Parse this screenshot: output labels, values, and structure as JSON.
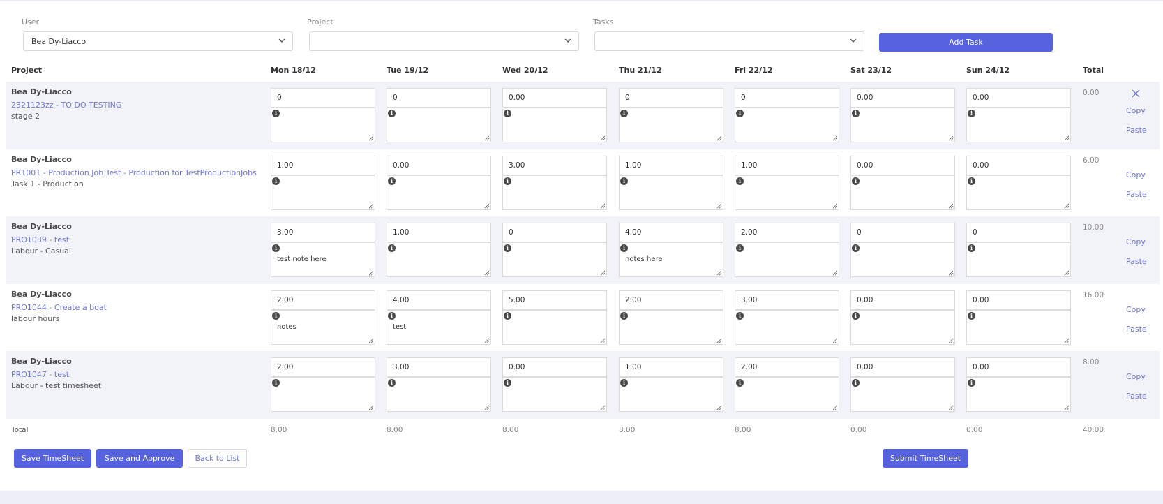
{
  "filters": {
    "user_label": "User",
    "user_value": "Bea Dy-Liacco",
    "project_label": "Project",
    "project_value": "",
    "tasks_label": "Tasks",
    "tasks_value": "",
    "add_task_label": "Add Task"
  },
  "table": {
    "project_header": "Project",
    "days": [
      "Mon 18/12",
      "Tue 19/12",
      "Wed 20/12",
      "Thu 21/12",
      "Fri 22/12",
      "Sat 23/12",
      "Sun 24/12"
    ],
    "total_header": "Total",
    "copy_label": "Copy",
    "paste_label": "Paste",
    "rows": [
      {
        "user": "Bea Dy-Liacco",
        "project": "2321123zz - TO DO TESTING",
        "task": "stage 2",
        "hours": [
          "0",
          "0",
          "0.00",
          "0",
          "0",
          "0.00",
          "0.00"
        ],
        "notes": [
          "",
          "",
          "",
          "",
          "",
          "",
          ""
        ],
        "total": "0.00",
        "removable": true
      },
      {
        "user": "Bea Dy-Liacco",
        "project": "PR1001 - Production Job Test - Production for TestProductionJobs",
        "task": "Task 1 - Production",
        "hours": [
          "1.00",
          "0.00",
          "3.00",
          "1.00",
          "1.00",
          "0.00",
          "0.00"
        ],
        "notes": [
          "",
          "",
          "",
          "",
          "",
          "",
          ""
        ],
        "total": "6.00",
        "removable": false
      },
      {
        "user": "Bea Dy-Liacco",
        "project": "PRO1039 - test",
        "task": "Labour - Casual",
        "hours": [
          "3.00",
          "1.00",
          "0",
          "4.00",
          "2.00",
          "0",
          "0"
        ],
        "notes": [
          "test note here",
          "",
          "",
          "notes here",
          "",
          "",
          ""
        ],
        "total": "10.00",
        "removable": false
      },
      {
        "user": "Bea Dy-Liacco",
        "project": "PRO1044 - Create a boat",
        "task": "labour hours",
        "hours": [
          "2.00",
          "4.00",
          "5.00",
          "2.00",
          "3.00",
          "0.00",
          "0.00"
        ],
        "notes": [
          "notes",
          "test",
          "",
          "",
          "",
          "",
          ""
        ],
        "total": "16.00",
        "removable": false
      },
      {
        "user": "Bea Dy-Liacco",
        "project": "PRO1047 - test",
        "task": "Labour - test timesheet",
        "hours": [
          "2.00",
          "3.00",
          "0.00",
          "1.00",
          "2.00",
          "0.00",
          "0.00"
        ],
        "notes": [
          "",
          "",
          "",
          "",
          "",
          "",
          ""
        ],
        "total": "8.00",
        "removable": false
      }
    ],
    "totals_label": "Total",
    "day_totals": [
      "8.00",
      "8.00",
      "8.00",
      "8.00",
      "8.00",
      "0.00",
      "0.00"
    ],
    "grand_total": "40.00"
  },
  "actions": {
    "save_label": "Save TimeSheet",
    "save_approve_label": "Save and Approve",
    "back_label": "Back to List",
    "submit_label": "Submit TimeSheet"
  },
  "colors": {
    "accent": "#5662de",
    "link": "#6e76d8",
    "row_alt": "#f2f3f8"
  },
  "icons": {
    "info": "info-icon",
    "close": "close-icon",
    "chevron": "chevron-down-icon",
    "resize": "resize-grip-icon"
  }
}
